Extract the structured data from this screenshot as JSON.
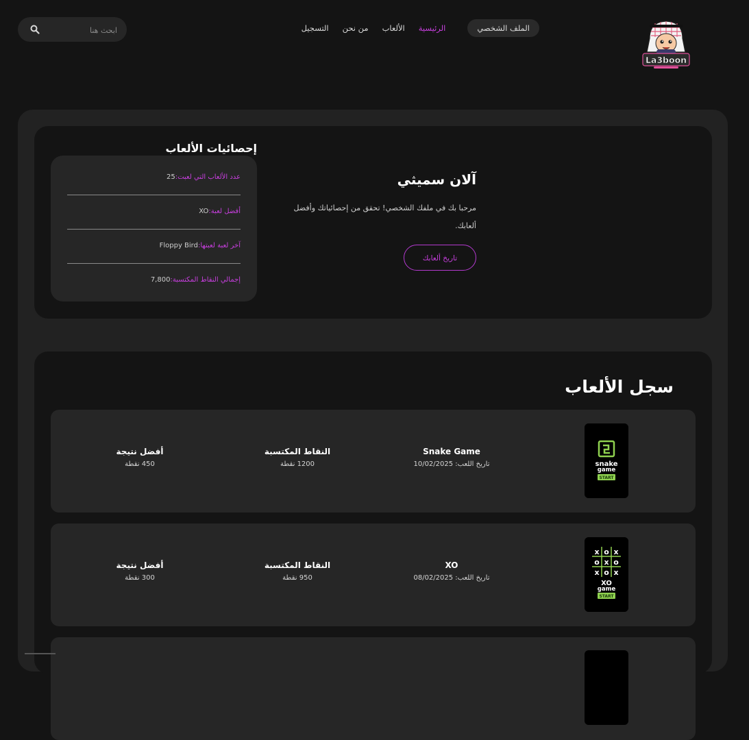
{
  "nav": {
    "search_placeholder": "ابحث هنا",
    "links": [
      {
        "label": "الملف الشخصي",
        "active": false
      },
      {
        "label": "الرئيسية",
        "active": true
      },
      {
        "label": "الألعاب",
        "active": false
      },
      {
        "label": "من نحن",
        "active": false
      },
      {
        "label": "التسجيل",
        "active": false
      }
    ],
    "logo_text": "La3boon"
  },
  "profile": {
    "name": "آلان سميثي",
    "welcome": "مرحبا بك في ملفك الشخصي! تحقق من إحصائياتك وأفضل ألعابك.",
    "history_button": "تاريخ ألعابك"
  },
  "stats": {
    "title": "إحصائيات الألعاب",
    "rows": [
      {
        "key": "عدد الألعاب التي لعبت:",
        "value": "25"
      },
      {
        "key": "أفضل لعبة:",
        "value": "XO"
      },
      {
        "key": "آخر لعبة لعبتها:",
        "value": "Floppy Bird"
      },
      {
        "key": "إجمالي النقاط المكتسبة:",
        "value": "7,800"
      }
    ]
  },
  "history": {
    "title": "سجل الألعاب",
    "games": [
      {
        "name": "Snake Game",
        "date": "تاريخ اللعب: 10/02/2025",
        "points_label": "النقاط المكتسبة",
        "points": "1200 نقطة",
        "best_label": "أفضل نتيجة",
        "best": "450 نقطة",
        "thumb_line1": "snake",
        "thumb_line2": "game",
        "thumb_start": "START"
      },
      {
        "name": "XO",
        "date": "تاريخ اللعب: 08/02/2025",
        "points_label": "النقاط المكتسبة",
        "points": "950 نقطة",
        "best_label": "أفضل نتيجة",
        "best": "300 نقطة",
        "thumb_line1": "XO",
        "thumb_line2": "game",
        "thumb_start": "START"
      }
    ]
  },
  "colors": {
    "accent": "#c93fe0",
    "background": "#141414",
    "panel": "#222222",
    "card": "#262626",
    "thumb_green": "#8fd14f"
  }
}
